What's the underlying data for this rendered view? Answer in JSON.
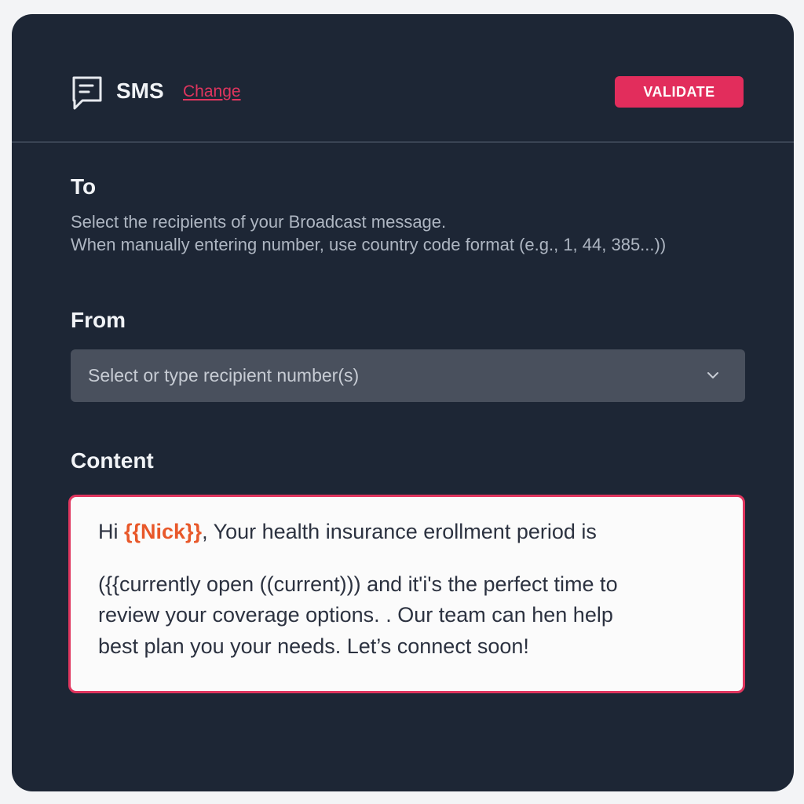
{
  "header": {
    "title": "SMS",
    "icon": "message-square-icon",
    "change_link": "Change",
    "validate_button": "VALIDATE"
  },
  "to": {
    "label": "To",
    "help_line_1": "Select the recipients of your Broadcast message.",
    "help_line_2": "When manually entering number, use country code format (e.g., 1, 44, 385...))"
  },
  "from": {
    "label": "From",
    "placeholder": "Select or type recipient number(s)",
    "dropdown_icon": "chevron-down-icon"
  },
  "content": {
    "label": "Content",
    "line_1_prefix": "Hi ",
    "line_1_variable": "{{Nick}}",
    "line_1_suffix": ", Your health insurance erollment period is",
    "line_2": "({{currently open ((current))) and it'i's the perfect time to",
    "line_3": "review your  coverage options. . Our team can hen help",
    "line_4": "best plan you your needs. Let’s connect soon!"
  },
  "colors": {
    "panel_background": "#1d2635",
    "accent": "#e22d5c",
    "variable_highlight": "#e8582a",
    "input_background": "#49505d"
  }
}
